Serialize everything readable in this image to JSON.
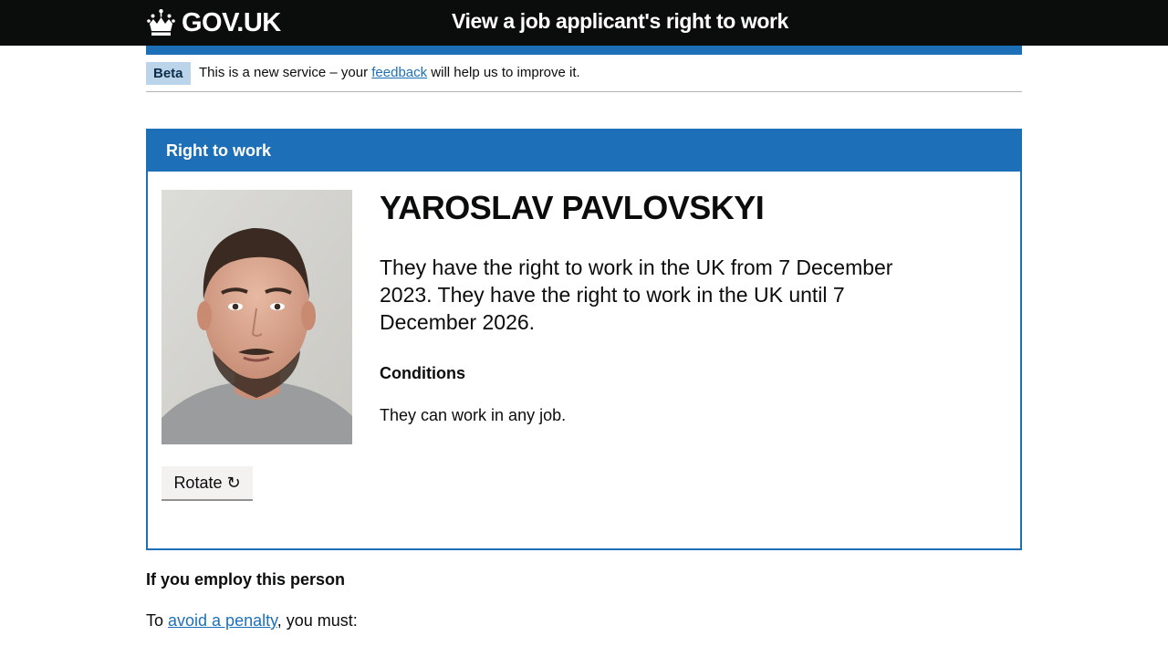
{
  "header": {
    "logo_text": "GOV.UK",
    "service_name": "View a job applicant's right to work"
  },
  "phase_banner": {
    "tag": "Beta",
    "text_before": "This is a new service – your ",
    "link": "feedback",
    "text_after": " will help us to improve it."
  },
  "card": {
    "title": "Right to work",
    "name": "YAROSLAV PAVLOVSKYI",
    "status": "They have the right to work in the UK from 7 December 2023. They have the right to work in the UK until 7 December 2026.",
    "conditions_heading": "Conditions",
    "conditions_text": "They can work in any job.",
    "rotate_label": "Rotate ↻"
  },
  "employer": {
    "heading": "If you employ this person",
    "text_before": "To ",
    "link": "avoid a penalty",
    "text_after": ", you must:"
  },
  "colors": {
    "header_bg": "#0b0c0c",
    "brand_blue": "#1d70b8",
    "tag_bg": "#bbd4ea",
    "link": "#1d70b8"
  }
}
